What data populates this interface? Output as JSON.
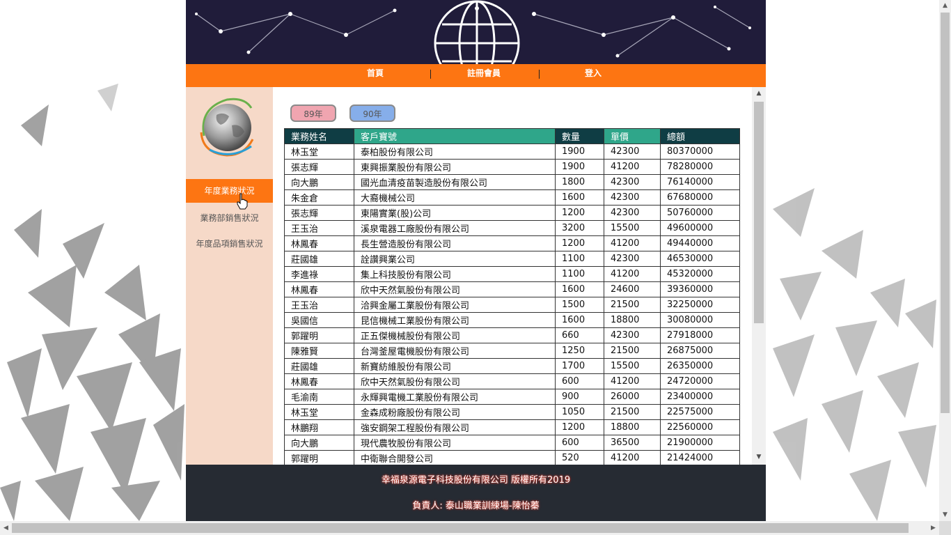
{
  "nav": {
    "home": "首頁",
    "register": "註冊會員",
    "login": "登入"
  },
  "sidebar": {
    "items": [
      {
        "label": "年度業務狀況",
        "active": true
      },
      {
        "label": "業務部銷售狀況",
        "active": false
      },
      {
        "label": "年度品項銷售狀況",
        "active": false
      }
    ]
  },
  "years": {
    "y89": "89年",
    "y90": "90年"
  },
  "table": {
    "headers": [
      "業務姓名",
      "客戶寶號",
      "數量",
      "單價",
      "總額"
    ],
    "rows": [
      [
        "林玉堂",
        "泰柏股份有限公司",
        "1900",
        "42300",
        "80370000"
      ],
      [
        "張志輝",
        "東興振業股份有限公司",
        "1900",
        "41200",
        "78280000"
      ],
      [
        "向大鵬",
        "國光血清疫苗製造股份有限公司",
        "1800",
        "42300",
        "76140000"
      ],
      [
        "朱金倉",
        "大裔機械公司",
        "1600",
        "42300",
        "67680000"
      ],
      [
        "張志輝",
        "東陽實業(股)公司",
        "1200",
        "42300",
        "50760000"
      ],
      [
        "王玉治",
        "溪泉電器工廠股份有限公司",
        "3200",
        "15500",
        "49600000"
      ],
      [
        "林鳳春",
        "長生營造股份有限公司",
        "1200",
        "41200",
        "49440000"
      ],
      [
        "莊國雄",
        "詮讚興業公司",
        "1100",
        "42300",
        "46530000"
      ],
      [
        "李進祿",
        "集上科技股份有限公司",
        "1100",
        "41200",
        "45320000"
      ],
      [
        "林鳳春",
        "欣中天然氣股份有限公司",
        "1600",
        "24600",
        "39360000"
      ],
      [
        "王玉治",
        "洽興金屬工業股份有限公司",
        "1500",
        "21500",
        "32250000"
      ],
      [
        "吳國信",
        "昆信機械工業股份有限公司",
        "1600",
        "18800",
        "30080000"
      ],
      [
        "郭躍明",
        "正五傑機械股份有限公司",
        "660",
        "42300",
        "27918000"
      ],
      [
        "陳雅賢",
        "台灣釜屋電機股份有限公司",
        "1250",
        "21500",
        "26875000"
      ],
      [
        "莊國雄",
        "新寶紡維股份有限公司",
        "1700",
        "15500",
        "26350000"
      ],
      [
        "林鳳春",
        "欣中天然氣股份有限公司",
        "600",
        "41200",
        "24720000"
      ],
      [
        "毛渝南",
        "永輝興電機工業股份有限公司",
        "900",
        "26000",
        "23400000"
      ],
      [
        "林玉堂",
        "金森成粉廠股份有限公司",
        "1050",
        "21500",
        "22575000"
      ],
      [
        "林鵬翔",
        "強安鋼架工程股份有限公司",
        "1200",
        "18800",
        "22560000"
      ],
      [
        "向大鵬",
        "現代農牧股份有限公司",
        "600",
        "36500",
        "21900000"
      ],
      [
        "郭躍明",
        "中衛聯合開發公司",
        "520",
        "41200",
        "21424000"
      ]
    ]
  },
  "footer": {
    "copyright": "幸福泉源電子科技股份有限公司 版權所有2019",
    "contact": "負責人: 泰山職業訓練場-陳怡蓁"
  },
  "icons": [
    "globe-banner",
    "globe-logo",
    "hand-cursor-icon",
    "scroll-up-arrow",
    "scroll-down-arrow"
  ],
  "colors": {
    "nav": "#fd7512",
    "banner": "#201c3a",
    "sidebar": "#f6d9c8",
    "header_dark": "#0f3d44",
    "header_teal": "#2fa68a",
    "footer": "#262b33",
    "btn89": "#f0a5b0",
    "btn90": "#86aeea"
  }
}
